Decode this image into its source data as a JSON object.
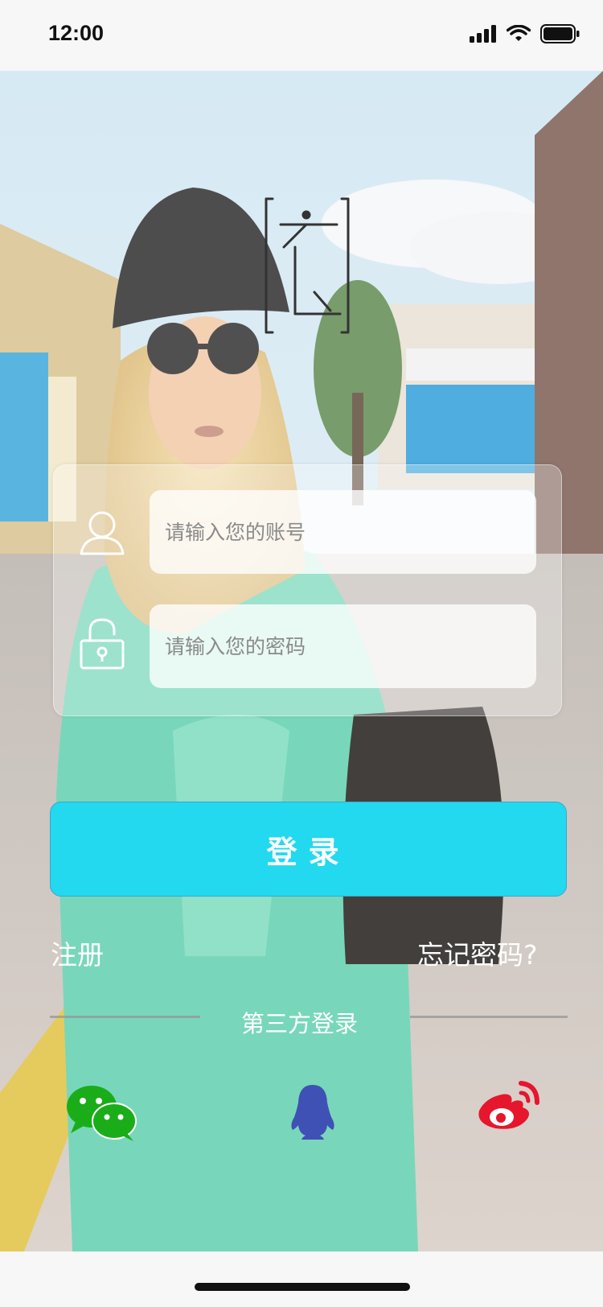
{
  "status_bar": {
    "time": "12:00"
  },
  "login_form": {
    "account_placeholder": "请输入您的账号",
    "password_placeholder": "请输入您的密码",
    "login_label": "登录"
  },
  "links": {
    "register": "注册",
    "forgot_password": "忘记密码?"
  },
  "third_party": {
    "label": "第三方登录",
    "providers": [
      {
        "name": "wechat",
        "icon": "wechat-icon",
        "color": "#1aad19"
      },
      {
        "name": "qq",
        "icon": "qq-penguin-icon",
        "color": "#3f51b5"
      },
      {
        "name": "weibo",
        "icon": "weibo-icon",
        "color": "#e6162d"
      }
    ]
  },
  "colors": {
    "accent": "#22d9ef",
    "background_overlay": "#ffffff"
  }
}
